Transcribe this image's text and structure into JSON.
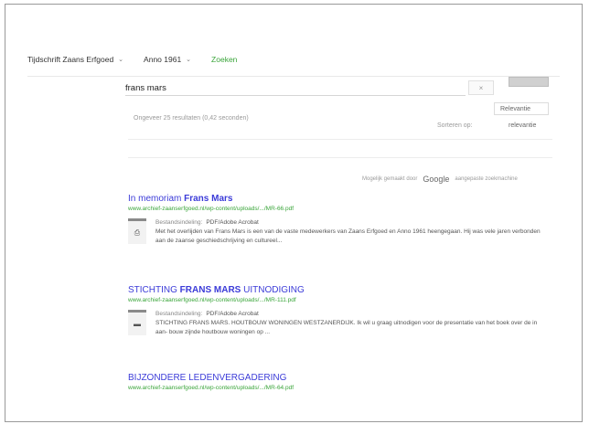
{
  "nav": {
    "items": [
      {
        "label": "Tijdschrift Zaans Erfgoed",
        "has_caret": true
      },
      {
        "label": "Anno 1961",
        "has_caret": true
      },
      {
        "label": "Zoeken",
        "has_caret": false
      }
    ]
  },
  "search": {
    "value": "frans mars",
    "clear_label": "×",
    "stats": "Ongeveer 25 resultaten (0,42 seconden)",
    "sort_select": "Relevantie",
    "sort_label": "Sorteren op:",
    "sort_value": "relevantie"
  },
  "powered": {
    "prefix": "Mogelijk gemaakt door",
    "brand": "Google",
    "suffix": "aangepaste zoekmachine"
  },
  "results": [
    {
      "title_pre": "In memoriam ",
      "title_bold": "Frans Mars",
      "url": "www.archief-zaanserfgoed.nl/wp-content/uploads/.../MR-66.pdf",
      "meta_label": "Bestandsindeling:",
      "meta_format": "PDF/Adobe Acrobat",
      "thumb_icon": "pdf-icon",
      "snippet": "Met het overlijden van Frans Mars is een van de vaste medewerkers van Zaans Erfgoed en Anno 1961 heengegaan. Hij was vele jaren verbonden aan de zaanse geschiedschrijving en cultureel..."
    },
    {
      "title_pre": "STICHTING ",
      "title_bold": "FRANS MARS",
      "title_post": " UITNODIGING",
      "url": "www.archief-zaanserfgoed.nl/wp-content/uploads/.../MR-111.pdf",
      "meta_label": "Bestandsindeling:",
      "meta_format": "PDF/Adobe Acrobat",
      "thumb_icon": "document-icon",
      "snippet": "STICHTING FRANS MARS. HOUTBOUW WONINGEN WESTZANERDIJK. Ik wil u graag uitnodigen voor de presentatie van het boek over de in aan- bouw zijnde houtbouw woningen op ..."
    },
    {
      "title_pre": "BIJZONDERE LEDENVERGADERING",
      "title_bold": "",
      "url": "www.archief-zaanserfgoed.nl/wp-content/uploads/.../MR-64.pdf"
    }
  ]
}
